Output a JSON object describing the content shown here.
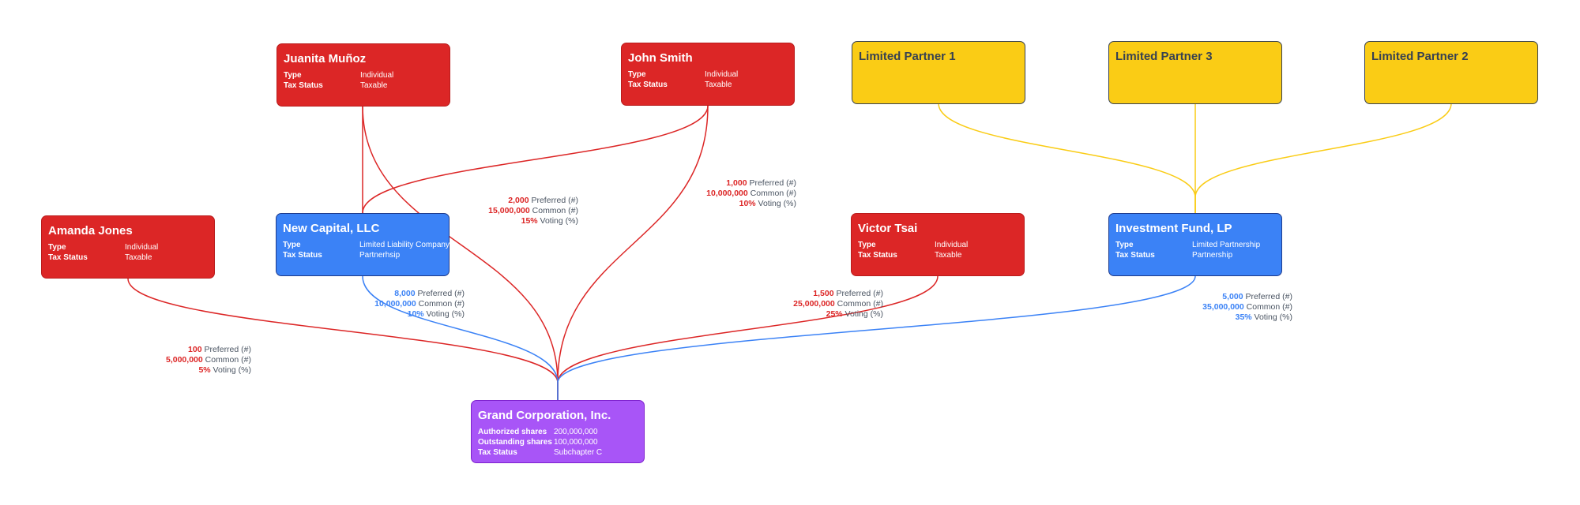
{
  "colors": {
    "individual": "#dc2626",
    "entity": "#3b82f6",
    "limited_partner": "#facc15",
    "target": "#a855f7",
    "edge_red": "#dc2626",
    "edge_blue": "#3b82f6",
    "edge_yellow": "#facc15"
  },
  "nodes": {
    "juanita": {
      "title": "Juanita Muñoz",
      "rows": [
        {
          "k": "Type",
          "v": "Individual"
        },
        {
          "k": "Tax Status",
          "v": "Taxable"
        }
      ]
    },
    "john": {
      "title": "John Smith",
      "rows": [
        {
          "k": "Type",
          "v": "Individual"
        },
        {
          "k": "Tax Status",
          "v": "Taxable"
        }
      ]
    },
    "lp1": {
      "title": "Limited Partner 1"
    },
    "lp3": {
      "title": "Limited Partner 3"
    },
    "lp2": {
      "title": "Limited Partner 2"
    },
    "amanda": {
      "title": "Amanda Jones",
      "rows": [
        {
          "k": "Type",
          "v": "Individual"
        },
        {
          "k": "Tax Status",
          "v": "Taxable"
        }
      ]
    },
    "newcap": {
      "title": "New Capital, LLC",
      "rows": [
        {
          "k": "Type",
          "v": "Limited Liability Company"
        },
        {
          "k": "Tax Status",
          "v": "Partnerhsip"
        }
      ]
    },
    "victor": {
      "title": "Victor Tsai",
      "rows": [
        {
          "k": "Type",
          "v": "Individual"
        },
        {
          "k": "Tax Status",
          "v": "Taxable"
        }
      ]
    },
    "fund": {
      "title": "Investment Fund, LP",
      "rows": [
        {
          "k": "Type",
          "v": "Limited Partnership"
        },
        {
          "k": "Tax Status",
          "v": "Partnership"
        }
      ]
    },
    "grand": {
      "title": "Grand Corporation, Inc.",
      "rows": [
        {
          "k": "Authorized shares",
          "v": "200,000,000"
        },
        {
          "k": "Outstanding shares",
          "v": "100,000,000"
        },
        {
          "k": "Tax Status",
          "v": "Subchapter C"
        }
      ]
    }
  },
  "edges": [
    {
      "from": "juanita",
      "to": "newcap",
      "color": "red"
    },
    {
      "from": "john",
      "to": "newcap",
      "color": "red"
    },
    {
      "from": "juanita",
      "to": "grand",
      "color": "red"
    },
    {
      "from": "john",
      "to": "grand",
      "color": "red"
    },
    {
      "from": "amanda",
      "to": "grand",
      "color": "red"
    },
    {
      "from": "newcap",
      "to": "grand",
      "color": "blue"
    },
    {
      "from": "victor",
      "to": "grand",
      "color": "red"
    },
    {
      "from": "fund",
      "to": "grand",
      "color": "blue"
    },
    {
      "from": "lp1",
      "to": "fund",
      "color": "yellow"
    },
    {
      "from": "lp3",
      "to": "fund",
      "color": "yellow"
    },
    {
      "from": "lp2",
      "to": "fund",
      "color": "yellow"
    }
  ],
  "holdings": {
    "juanita": [
      {
        "v": "2,000",
        "k": "Preferred (#)"
      },
      {
        "v": "15,000,000",
        "k": "Common (#)"
      },
      {
        "v": "15%",
        "k": "Voting (%)"
      }
    ],
    "john": [
      {
        "v": "1,000",
        "k": "Preferred (#)"
      },
      {
        "v": "10,000,000",
        "k": "Common (#)"
      },
      {
        "v": "10%",
        "k": "Voting (%)"
      }
    ],
    "newcap": [
      {
        "v": "8,000",
        "k": "Preferred (#)"
      },
      {
        "v": "10,000,000",
        "k": "Common (#)"
      },
      {
        "v": "10%",
        "k": "Voting (%)"
      }
    ],
    "victor": [
      {
        "v": "1,500",
        "k": "Preferred (#)"
      },
      {
        "v": "25,000,000",
        "k": "Common (#)"
      },
      {
        "v": "25%",
        "k": "Voting (%)"
      }
    ],
    "fund": [
      {
        "v": "5,000",
        "k": "Preferred (#)"
      },
      {
        "v": "35,000,000",
        "k": "Common (#)"
      },
      {
        "v": "35%",
        "k": "Voting (%)"
      }
    ],
    "amanda": [
      {
        "v": "100",
        "k": "Preferred (#)"
      },
      {
        "v": "5,000,000",
        "k": "Common (#)"
      },
      {
        "v": "5%",
        "k": "Voting (%)"
      }
    ]
  }
}
